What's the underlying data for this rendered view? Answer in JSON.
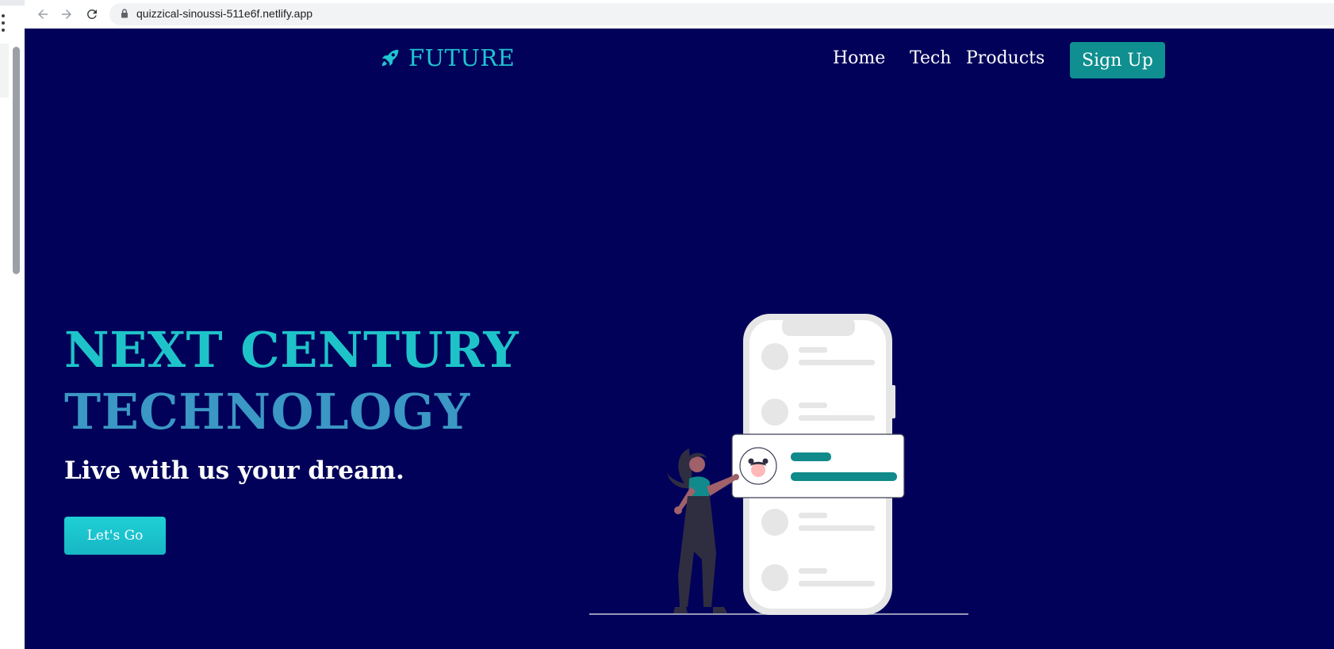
{
  "browser": {
    "url": "quizzical-sinoussi-511e6f.netlify.app",
    "back_icon": "arrow-left-icon",
    "forward_icon": "arrow-right-icon",
    "reload_icon": "reload-icon",
    "lock_icon": "lock-icon"
  },
  "brand": {
    "name": "FUTURE",
    "icon": "rocket-icon"
  },
  "nav": {
    "items": [
      {
        "label": "Home"
      },
      {
        "label": "Tech"
      },
      {
        "label": "Products"
      }
    ],
    "signup_label": "Sign Up"
  },
  "hero": {
    "title_line1": "NEXT CENTURY",
    "title_line2": "TECHNOLOGY",
    "subtitle": "Live with us your dream.",
    "cta_label": "Let's Go"
  },
  "colors": {
    "background": "#02015a",
    "accent": "#1fc6d0",
    "accent_secondary": "#3b97c4",
    "button": "#0f8f8f"
  }
}
